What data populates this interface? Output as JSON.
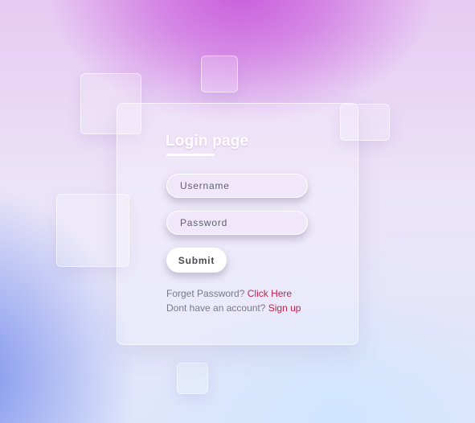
{
  "login": {
    "title": "Login page",
    "username_placeholder": "Username",
    "password_placeholder": "Password",
    "submit_label": "Submit",
    "forgot_text": "Forget Password?",
    "forgot_link": "Click Here",
    "signup_text": "Dont have an account?",
    "signup_link": "Sign up"
  },
  "colors": {
    "link": "#c0234d",
    "title": "#ffffff"
  }
}
